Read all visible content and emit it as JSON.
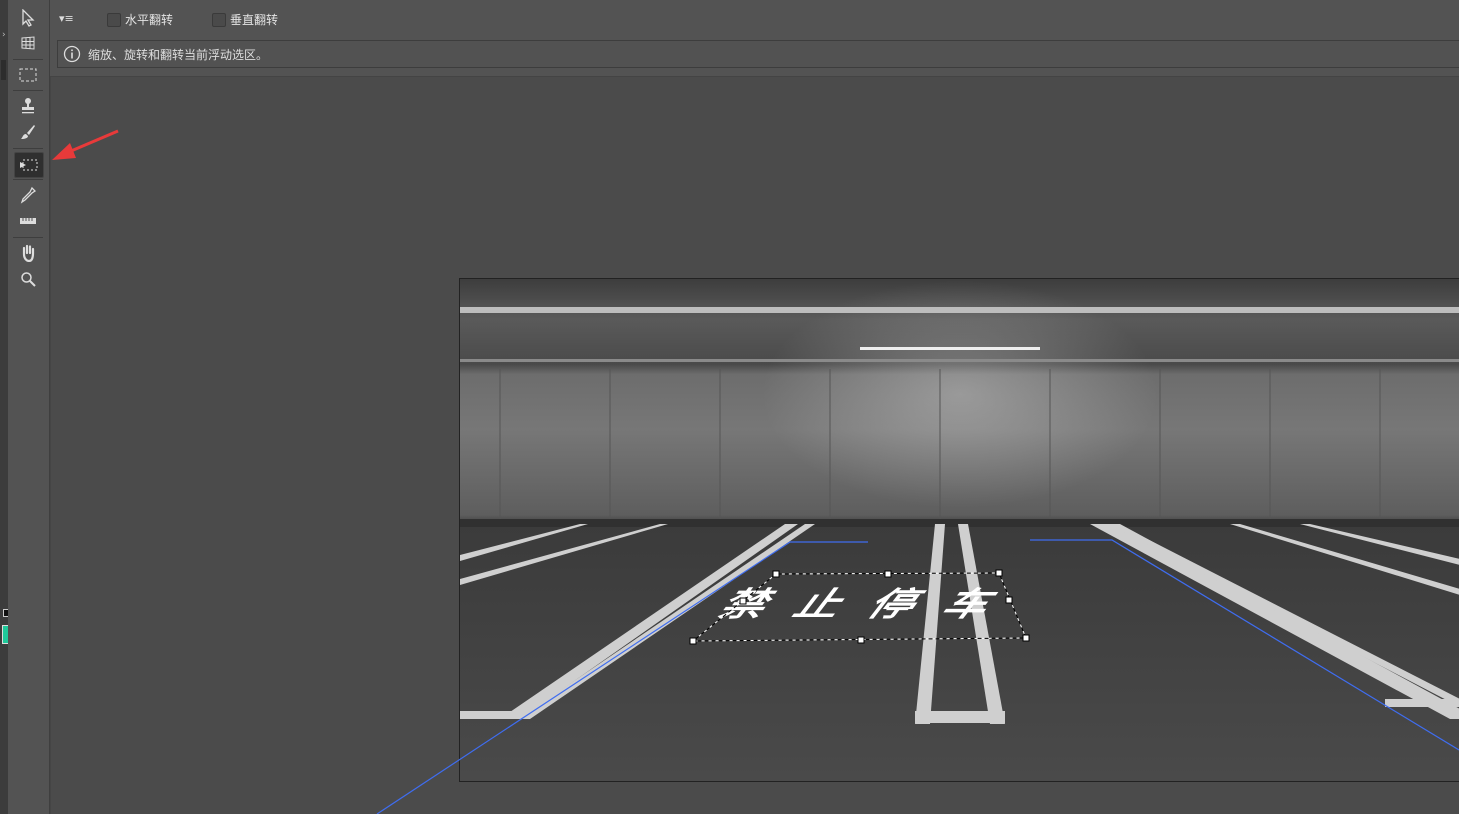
{
  "options": {
    "menu_icon": "flyout-menu-icon",
    "flip_horizontal": {
      "label": "水平翻转",
      "checked": false
    },
    "flip_vertical": {
      "label": "垂直翻转",
      "checked": false
    }
  },
  "info": {
    "icon": "info-icon",
    "text": "缩放、旋转和翻转当前浮动选区。"
  },
  "tools": [
    "edit-plane-tool",
    "create-plane-tool",
    "marquee-tool",
    "stamp-tool",
    "brush-tool",
    "transform-tool",
    "eyedropper-tool",
    "measure-tool",
    "hand-tool",
    "zoom-tool"
  ],
  "active_tool": "transform-tool",
  "annotation_color": "#e83a3a",
  "grid_color": "#3f6df0",
  "photo": {
    "floor_text": "禁止停车"
  }
}
